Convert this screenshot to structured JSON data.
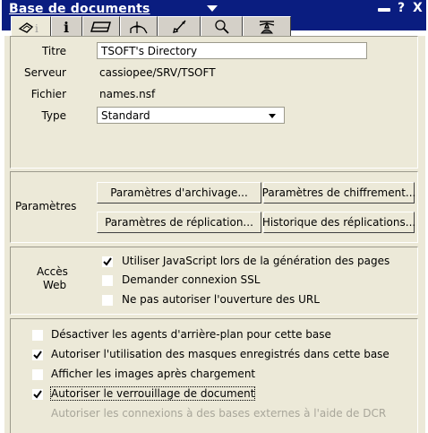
{
  "window": {
    "title": "Base de documents",
    "help_label": "?",
    "close_label": "X"
  },
  "tabs": [
    {
      "name": "info-tab",
      "icon": "info-cone-icon"
    },
    {
      "name": "details-tab",
      "icon": "info-icon"
    },
    {
      "name": "print-tab",
      "icon": "printer-icon"
    },
    {
      "name": "design-tab",
      "icon": "ruler-icon"
    },
    {
      "name": "launch-tab",
      "icon": "rocket-icon"
    },
    {
      "name": "search-tab",
      "icon": "magnifier-icon"
    },
    {
      "name": "advanced-tab",
      "icon": "propeller-hat-icon"
    }
  ],
  "info": {
    "titre_label": "Titre",
    "titre_value": "TSOFT's Directory",
    "serveur_label": "Serveur",
    "serveur_value": "cassiopee/SRV/TSOFT",
    "fichier_label": "Fichier",
    "fichier_value": "names.nsf",
    "type_label": "Type",
    "type_value": "Standard"
  },
  "parametres": {
    "label": "Paramètres",
    "archivage": "Paramètres d'archivage...",
    "chiffrement": "Paramètres de chiffrement...",
    "replication": "Paramètres de réplication...",
    "historique": "Historique des réplications..."
  },
  "web": {
    "label_line1": "Accès",
    "label_line2": "Web",
    "options": [
      {
        "label": "Utiliser JavaScript lors de la génération des pages",
        "checked": true
      },
      {
        "label": "Demander connexion SSL",
        "checked": false
      },
      {
        "label": "Ne pas autoriser l'ouverture des URL",
        "checked": false
      }
    ]
  },
  "options": [
    {
      "label": "Désactiver les agents d'arrière-plan pour cette base",
      "checked": false,
      "disabled": false
    },
    {
      "label": "Autoriser l'utilisation des masques enregistrés dans cette base",
      "checked": true,
      "disabled": false
    },
    {
      "label": "Afficher les images après chargement",
      "checked": false,
      "disabled": false
    },
    {
      "label": "Autoriser le verrouillage de document",
      "checked": true,
      "disabled": false
    },
    {
      "label": "Autoriser les connexions à des bases externes à l'aide de DCR",
      "checked": false,
      "disabled": true
    }
  ],
  "colors": {
    "titlebar": "#0a1d80",
    "face": "#ece9d8",
    "tab": "#d4d0c8",
    "disabled_text": "#a8a69a"
  }
}
